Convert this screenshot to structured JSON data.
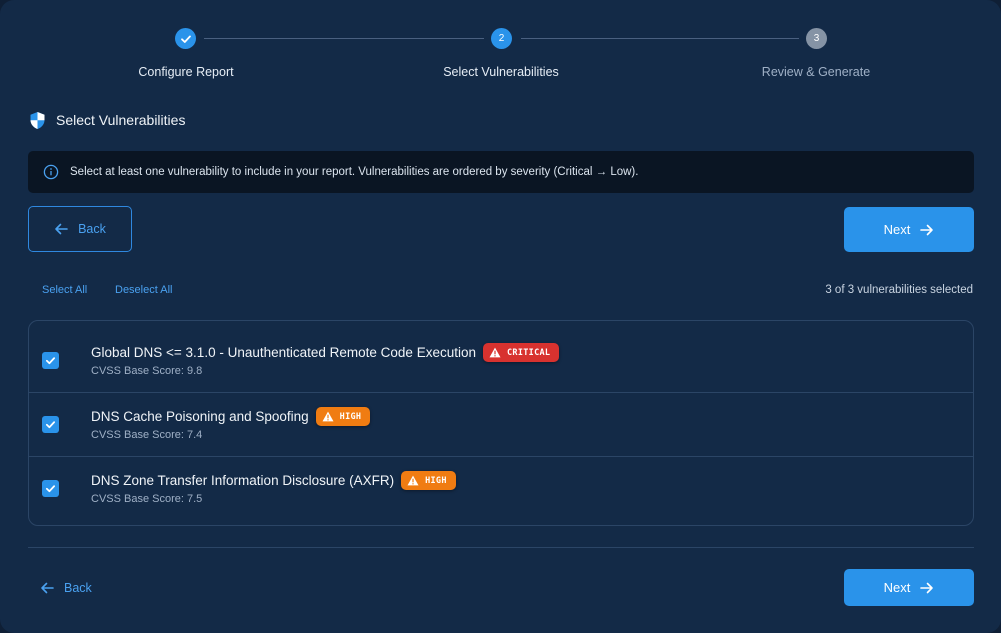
{
  "stepper": {
    "steps": [
      {
        "label": "Configure Report",
        "number": "",
        "state": "done"
      },
      {
        "label": "Select Vulnerabilities",
        "number": "2",
        "state": "active"
      },
      {
        "label": "Review & Generate",
        "number": "3",
        "state": "pending"
      }
    ]
  },
  "section": {
    "title": "Select Vulnerabilities"
  },
  "info": {
    "text": "Select at least one vulnerability to include in your report. Vulnerabilities are ordered by severity (Critical → Low)."
  },
  "nav": {
    "back_label": "Back",
    "next_label": "Next"
  },
  "selection": {
    "select_all": "Select All",
    "deselect_all": "Deselect All",
    "count_text": "3 of 3 vulnerabilities selected"
  },
  "vulnerabilities": [
    {
      "title": "Global DNS <= 3.1.0 - Unauthenticated Remote Code Execution",
      "severity": "CRITICAL",
      "score": "CVSS Base Score: 9.8",
      "checked": true
    },
    {
      "title": "DNS Cache Poisoning and Spoofing",
      "severity": "HIGH",
      "score": "CVSS Base Score: 7.4",
      "checked": true
    },
    {
      "title": "DNS Zone Transfer Information Disclosure (AXFR)",
      "severity": "HIGH",
      "score": "CVSS Base Score: 7.5",
      "checked": true
    }
  ],
  "colors": {
    "accent": "#2a93ea",
    "critical": "#d8322f",
    "high": "#f07c12",
    "background": "#132a47"
  }
}
